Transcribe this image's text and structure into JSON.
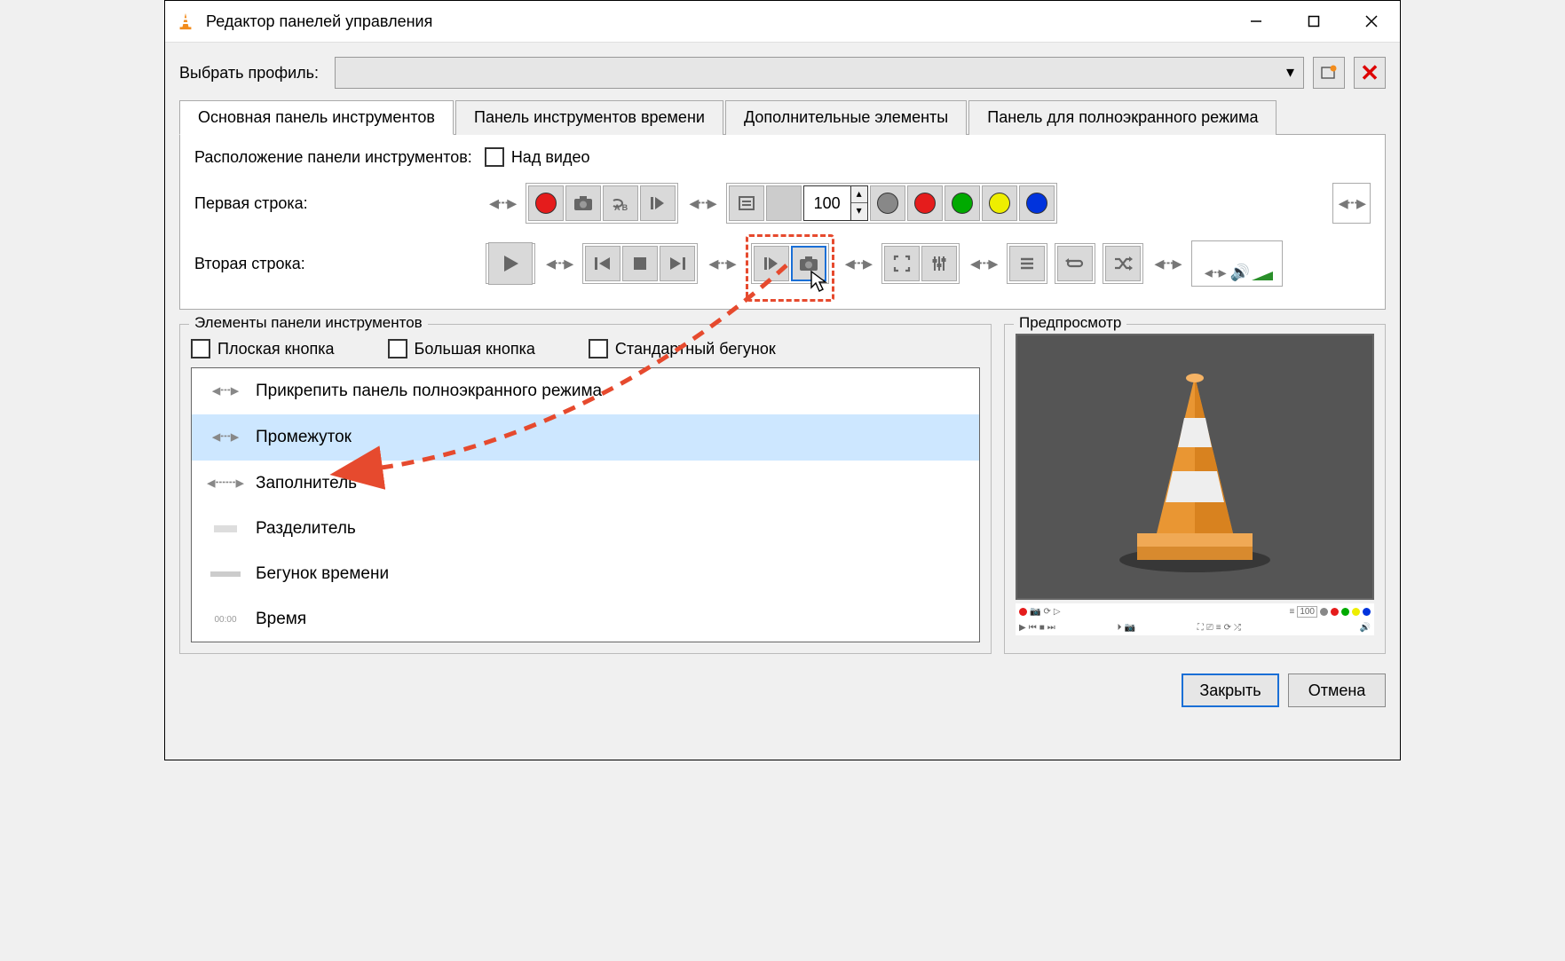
{
  "window": {
    "title": "Редактор панелей управления"
  },
  "profile": {
    "label": "Выбрать профиль:"
  },
  "tabs": {
    "main": "Основная панель инструментов",
    "time": "Панель инструментов времени",
    "extra": "Дополнительные элементы",
    "fullscreen": "Панель для полноэкранного режима"
  },
  "placement": {
    "label": "Расположение панели инструментов:",
    "above": "Над видео"
  },
  "rows": {
    "first": "Первая строка:",
    "second": "Вторая строка:"
  },
  "spinner": {
    "value": "100"
  },
  "elements": {
    "legend": "Элементы панели инструментов",
    "flat": "Плоская кнопка",
    "big": "Большая кнопка",
    "native": "Стандартный бегунок",
    "items": [
      "Прикрепить панель полноэкранного режима",
      "Промежуток",
      "Заполнитель",
      "Разделитель",
      "Бегунок времени",
      "Время"
    ]
  },
  "preview": {
    "legend": "Предпросмотр"
  },
  "buttons": {
    "close": "Закрыть",
    "cancel": "Отмена"
  }
}
